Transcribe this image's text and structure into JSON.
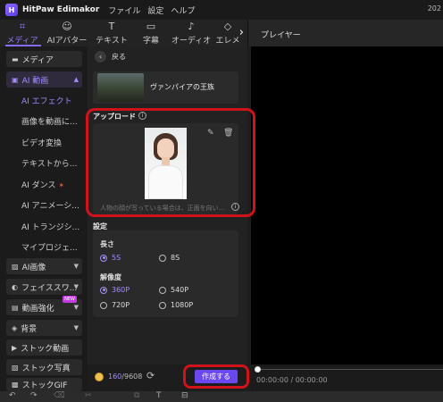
{
  "titlebar": {
    "app_name": "HitPaw Edimakor",
    "menus": [
      "ファイル",
      "設定",
      "ヘルプ"
    ],
    "year": "202"
  },
  "tabs": [
    {
      "label": "メディア",
      "icon": "media-icon"
    },
    {
      "label": "AIアバター",
      "icon": "avatar-icon"
    },
    {
      "label": "テキスト",
      "icon": "text-icon"
    },
    {
      "label": "字幕",
      "icon": "subtitle-icon"
    },
    {
      "label": "オーディオ",
      "icon": "music-icon"
    },
    {
      "label": "エレメ",
      "icon": "element-icon"
    }
  ],
  "player": {
    "title": "プレイヤー",
    "time": "00:00:00 / 00:00:00"
  },
  "sidebar": {
    "sections": [
      {
        "label": "メディア"
      },
      {
        "label": "AI 動画"
      },
      {
        "label": "AI画像"
      },
      {
        "label": "フェイススワ..."
      },
      {
        "label": "動画強化"
      },
      {
        "label": "背景"
      },
      {
        "label": "ストック動画"
      },
      {
        "label": "ストック写真"
      },
      {
        "label": "ストックGIF"
      }
    ],
    "items": [
      {
        "label": "AI エフェクト"
      },
      {
        "label": "画像を動画に..."
      },
      {
        "label": "ビデオ変換"
      },
      {
        "label": "テキストから..."
      },
      {
        "label": "AI ダンス"
      },
      {
        "label": "AI アニメーシ..."
      },
      {
        "label": "AI トランジシ..."
      },
      {
        "label": "マイプロジェ..."
      }
    ],
    "new_badge": "NEW"
  },
  "panel": {
    "back_label": "戻る",
    "effect_title": "ヴァンパイアの王族",
    "upload_label": "アップロード",
    "hint": "人物の顔が写っている場合は、正面を向い...",
    "settings_label": "設定",
    "length_label": "長さ",
    "length_options": [
      "5S",
      "8S"
    ],
    "length_selected": "5S",
    "resolution_label": "解像度",
    "resolution_options": [
      "360P",
      "540P",
      "720P",
      "1080P"
    ],
    "resolution_selected": "360P"
  },
  "actionbar": {
    "credits_used": "160",
    "credits_total": "/9608",
    "create_label": "作成する"
  },
  "colors": {
    "accent": "#6b47f0",
    "highlight_ring": "#d0121b"
  }
}
